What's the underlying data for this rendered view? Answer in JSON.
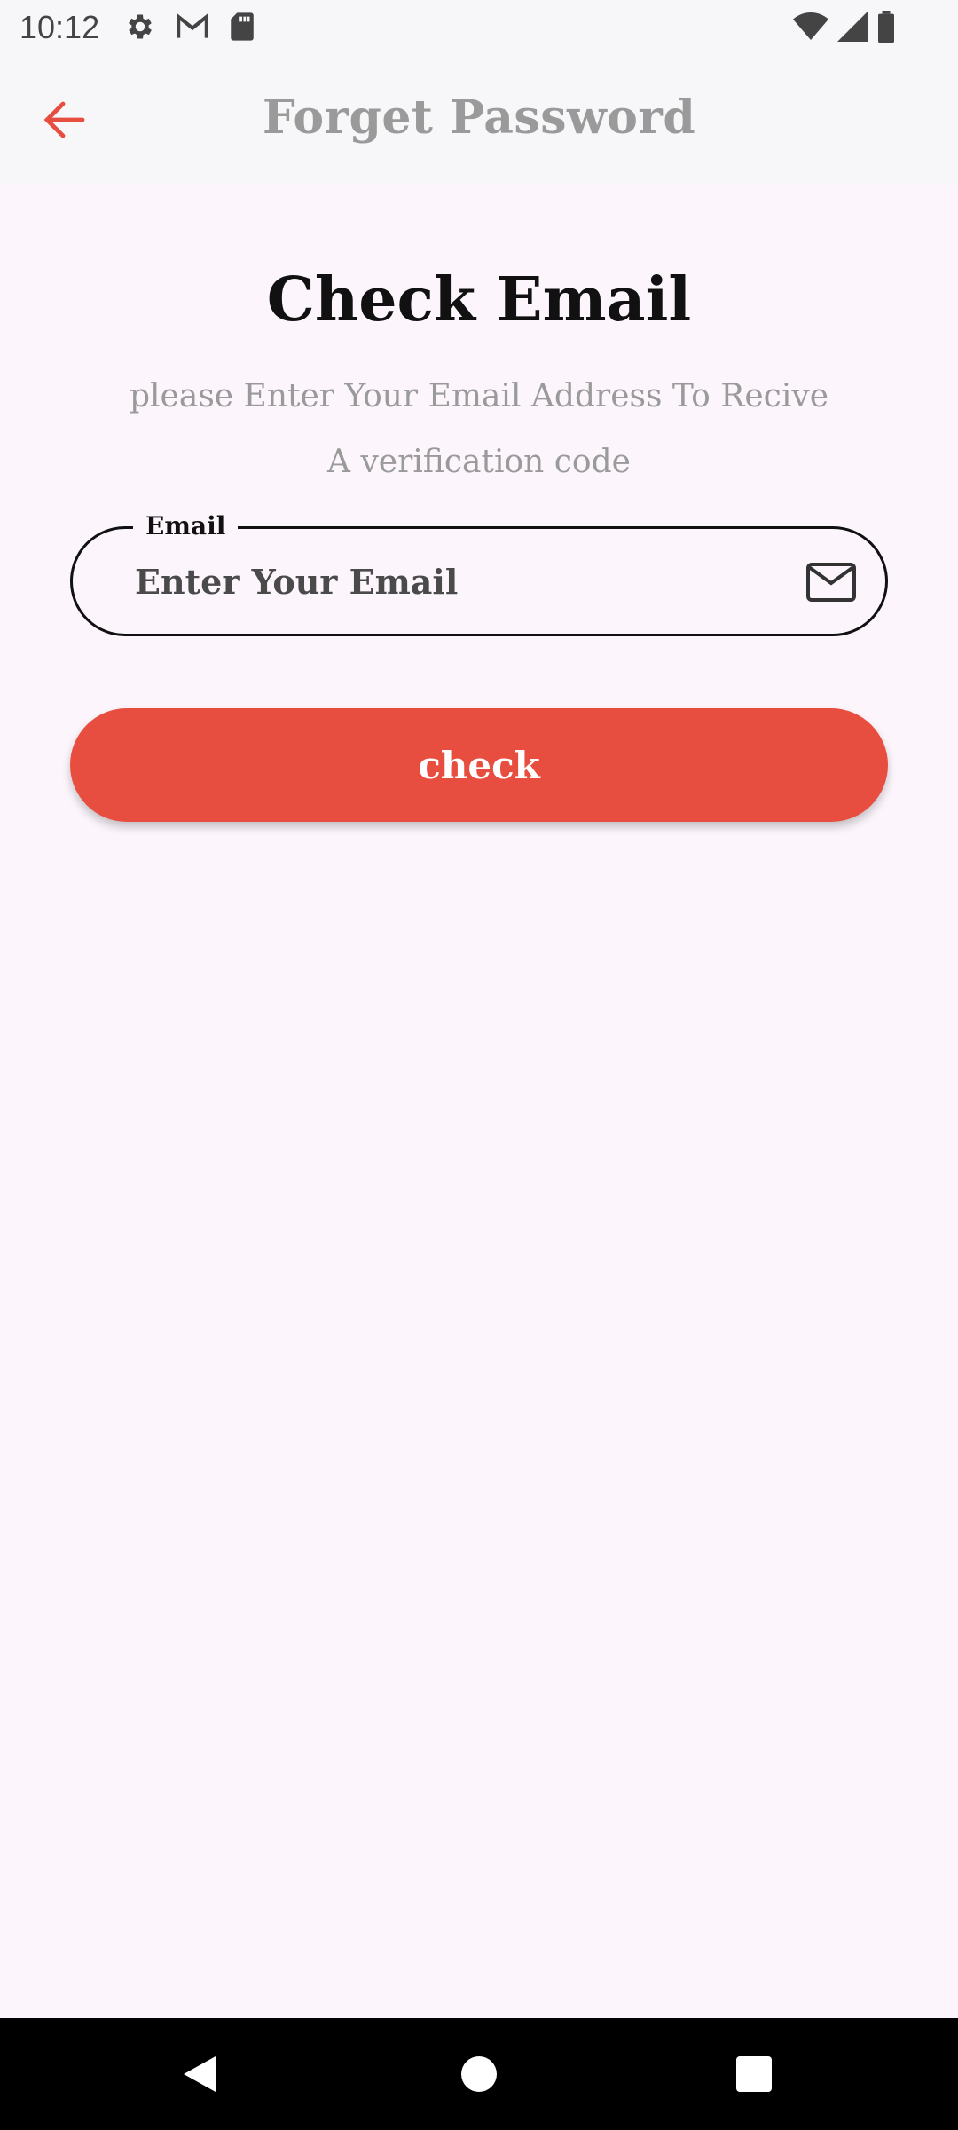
{
  "status_bar": {
    "time": "10:12",
    "left_icons": [
      "gear-icon",
      "gmail-icon",
      "sd-card-icon"
    ],
    "right_icons": [
      "wifi-icon",
      "signal-icon",
      "battery-icon"
    ]
  },
  "app_bar": {
    "title": "Forget Password",
    "back_icon": "arrow-left-icon",
    "accent_color": "#e84e3f"
  },
  "content": {
    "heading": "Check Email",
    "subtitle": "please Enter Your Email Address To Recive A verification code"
  },
  "email_field": {
    "label": "Email",
    "placeholder": "Enter Your Email",
    "value": "",
    "icon": "mail-icon"
  },
  "check_button": {
    "label": "check",
    "color": "#e84e3f"
  },
  "nav_bar": {
    "buttons": [
      "back-triangle-icon",
      "home-circle-icon",
      "recents-square-icon"
    ]
  }
}
